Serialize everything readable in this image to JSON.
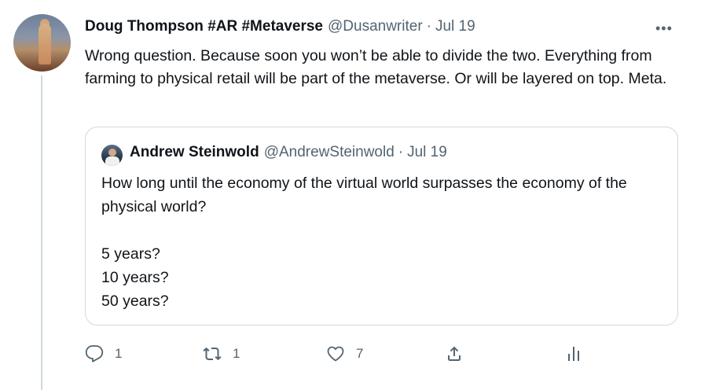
{
  "tweet": {
    "author_name": "Doug Thompson #AR #Metaverse",
    "author_handle": "@Dusanwriter",
    "separator": "·",
    "date": "Jul 19",
    "more_label": "•••",
    "text": "Wrong question. Because soon you won’t be able to divide the two. Everything from farming to physical retail will be part of the metaverse. Or will be layered on top. Meta."
  },
  "quoted_tweet": {
    "author_name": "Andrew Steinwold",
    "author_handle": "@AndrewSteinwold",
    "separator": "·",
    "date": "Jul 19",
    "question": "How long until the economy of the virtual world surpasses the economy of the physical world?",
    "options": [
      "5 years?",
      "10 years?",
      "50 years?"
    ]
  },
  "actions": {
    "reply_count": "1",
    "retweet_count": "1",
    "like_count": "7"
  },
  "icons": {
    "reply": "reply-icon",
    "retweet": "retweet-icon",
    "like": "heart-icon",
    "share": "share-icon",
    "analytics": "analytics-icon"
  },
  "colors": {
    "text_primary": "#0f1419",
    "text_secondary": "#536471",
    "border": "#cfd9de"
  }
}
